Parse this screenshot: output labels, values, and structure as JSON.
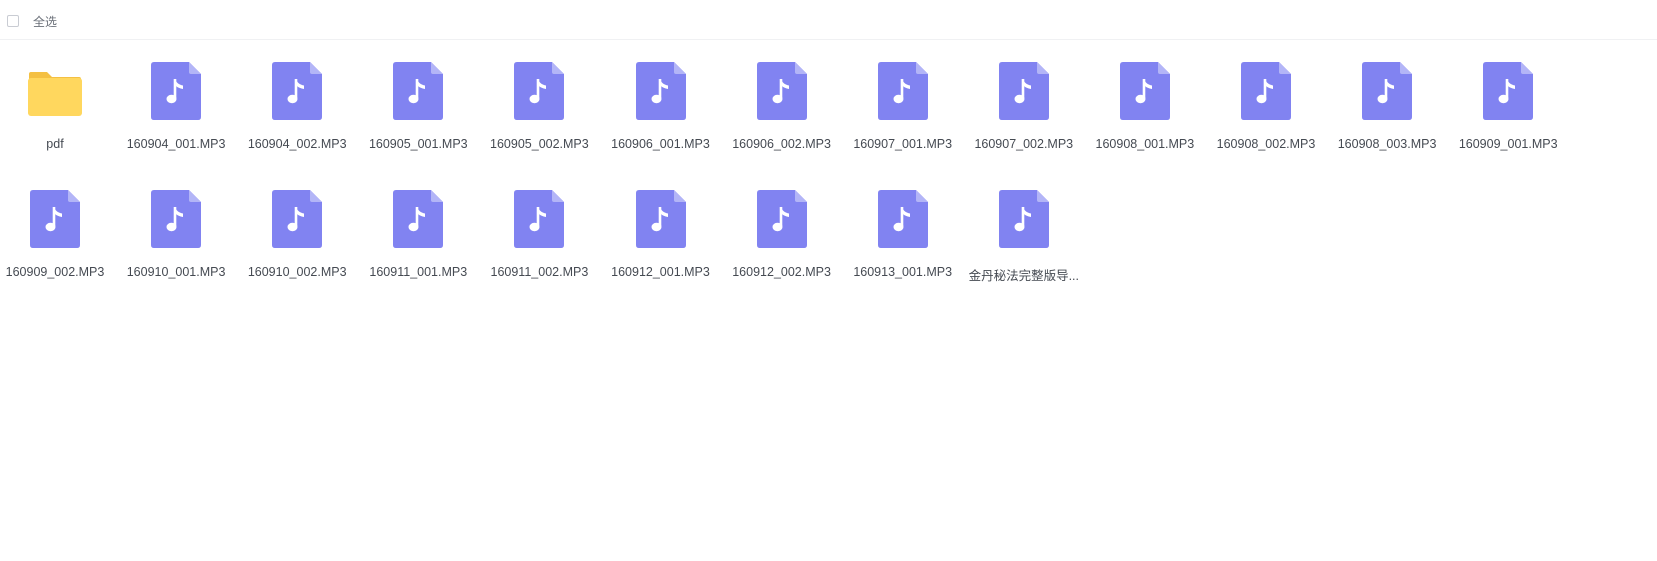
{
  "toolbar": {
    "select_all_label": "全选"
  },
  "colors": {
    "folder": "#ffd75e",
    "folder_tab": "#f4c043",
    "audio_file": "#8183f1",
    "audio_fold": "#b3b5f7"
  },
  "files": [
    {
      "name": "pdf",
      "icon": "folder-icon",
      "type": "folder"
    },
    {
      "name": "160904_001.MP3",
      "icon": "audio-file-icon",
      "type": "audio"
    },
    {
      "name": "160904_002.MP3",
      "icon": "audio-file-icon",
      "type": "audio"
    },
    {
      "name": "160905_001.MP3",
      "icon": "audio-file-icon",
      "type": "audio"
    },
    {
      "name": "160905_002.MP3",
      "icon": "audio-file-icon",
      "type": "audio"
    },
    {
      "name": "160906_001.MP3",
      "icon": "audio-file-icon",
      "type": "audio"
    },
    {
      "name": "160906_002.MP3",
      "icon": "audio-file-icon",
      "type": "audio"
    },
    {
      "name": "160907_001.MP3",
      "icon": "audio-file-icon",
      "type": "audio"
    },
    {
      "name": "160907_002.MP3",
      "icon": "audio-file-icon",
      "type": "audio"
    },
    {
      "name": "160908_001.MP3",
      "icon": "audio-file-icon",
      "type": "audio"
    },
    {
      "name": "160908_002.MP3",
      "icon": "audio-file-icon",
      "type": "audio"
    },
    {
      "name": "160908_003.MP3",
      "icon": "audio-file-icon",
      "type": "audio"
    },
    {
      "name": "160909_001.MP3",
      "icon": "audio-file-icon",
      "type": "audio"
    },
    {
      "name": "160909_002.MP3",
      "icon": "audio-file-icon",
      "type": "audio"
    },
    {
      "name": "160910_001.MP3",
      "icon": "audio-file-icon",
      "type": "audio"
    },
    {
      "name": "160910_002.MP3",
      "icon": "audio-file-icon",
      "type": "audio"
    },
    {
      "name": "160911_001.MP3",
      "icon": "audio-file-icon",
      "type": "audio"
    },
    {
      "name": "160911_002.MP3",
      "icon": "audio-file-icon",
      "type": "audio"
    },
    {
      "name": "160912_001.MP3",
      "icon": "audio-file-icon",
      "type": "audio"
    },
    {
      "name": "160912_002.MP3",
      "icon": "audio-file-icon",
      "type": "audio"
    },
    {
      "name": "160913_001.MP3",
      "icon": "audio-file-icon",
      "type": "audio"
    },
    {
      "name": "金丹秘法完整版导...",
      "icon": "audio-file-icon",
      "type": "audio"
    }
  ]
}
